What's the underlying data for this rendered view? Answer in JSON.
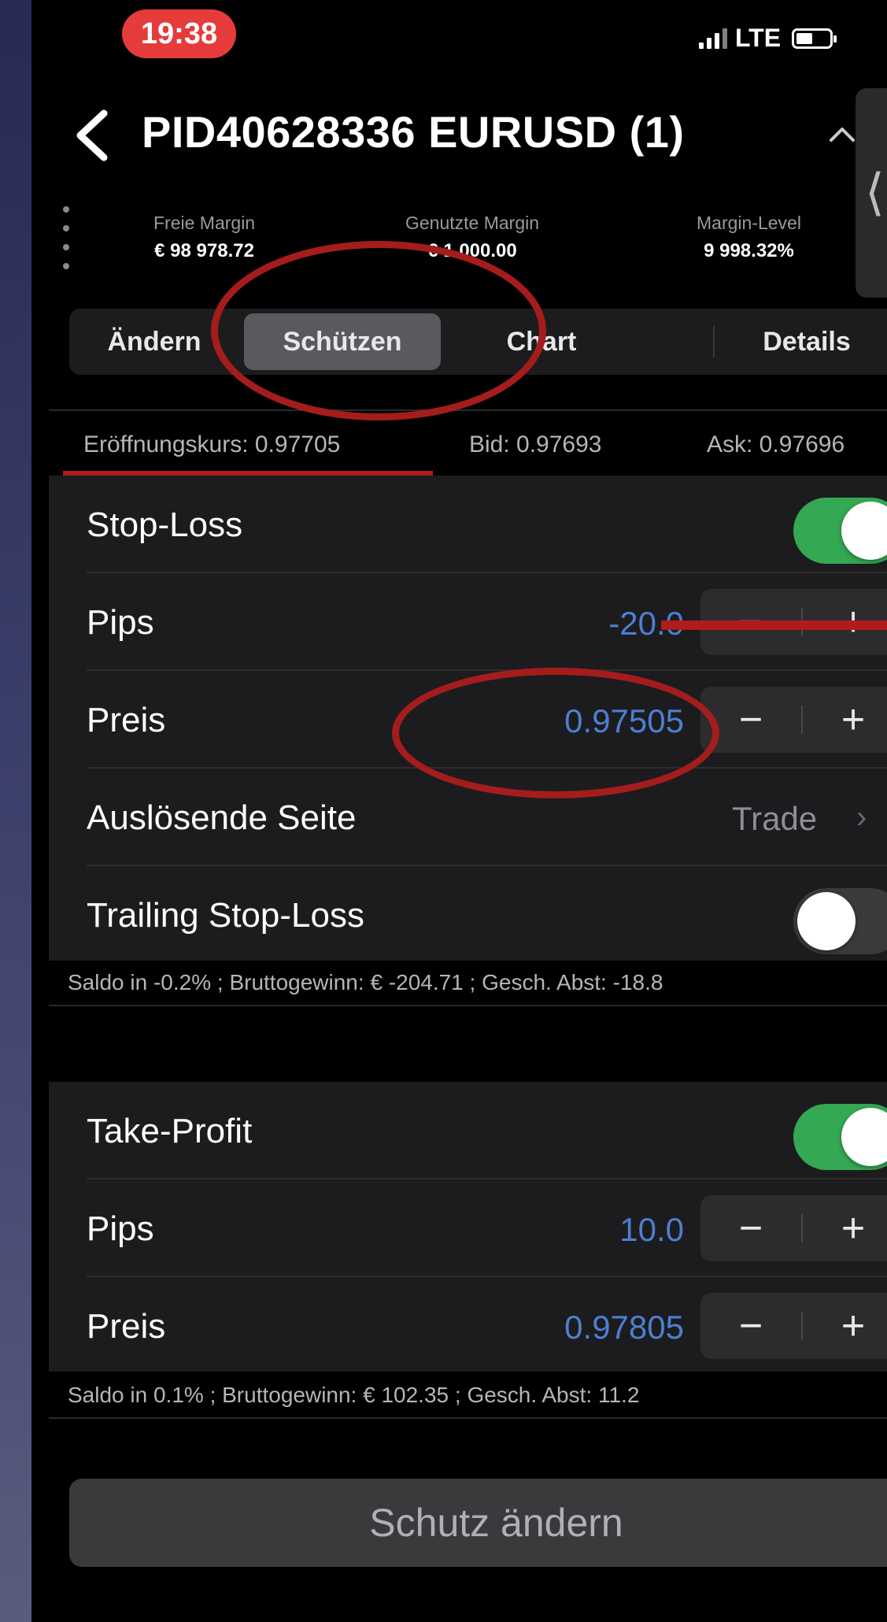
{
  "status_bar": {
    "time": "19:38",
    "network": "LTE"
  },
  "nav": {
    "title": "PID40628336 EURUSD (1)",
    "side_tab_glyph": "⟨"
  },
  "margins": [
    {
      "label": "Freie Margin",
      "value": "€ 98 978.72"
    },
    {
      "label": "Genutzte Margin",
      "value": "€ 1 000.00"
    },
    {
      "label": "Margin-Level",
      "value": "9 998.32%"
    }
  ],
  "tabs": [
    {
      "label": "Ändern"
    },
    {
      "label": "Schützen",
      "active": true
    },
    {
      "label": "Chart"
    },
    {
      "label": "Details"
    }
  ],
  "quotes": {
    "open": "Eröffnungskurs: 0.97705",
    "bid": "Bid: 0.97693",
    "ask": "Ask: 0.97696"
  },
  "stop_loss": {
    "title": "Stop-Loss",
    "enabled": true,
    "pips_label": "Pips",
    "pips_value": "-20.0",
    "price_label": "Preis",
    "price_value": "0.97505",
    "trigger_label": "Auslösende Seite",
    "trigger_value": "Trade",
    "trailing_label": "Trailing Stop-Loss",
    "trailing_enabled": false,
    "summary": "Saldo in -0.2% ; Bruttogewinn: € -204.71 ; Gesch. Abst: -18.8"
  },
  "take_profit": {
    "title": "Take-Profit",
    "enabled": true,
    "pips_label": "Pips",
    "pips_value": "10.0",
    "price_label": "Preis",
    "price_value": "0.97805",
    "summary": "Saldo in 0.1% ; Bruttogewinn: € 102.35 ; Gesch. Abst: 11.2"
  },
  "stepper": {
    "minus": "−",
    "plus": "+"
  },
  "action_button": "Schutz ändern",
  "colors": {
    "toggle_on": "#34a853",
    "value_blue": "#4d7fd0",
    "annotation_red": "#a51c1c",
    "time_pill": "#e63b3b"
  }
}
